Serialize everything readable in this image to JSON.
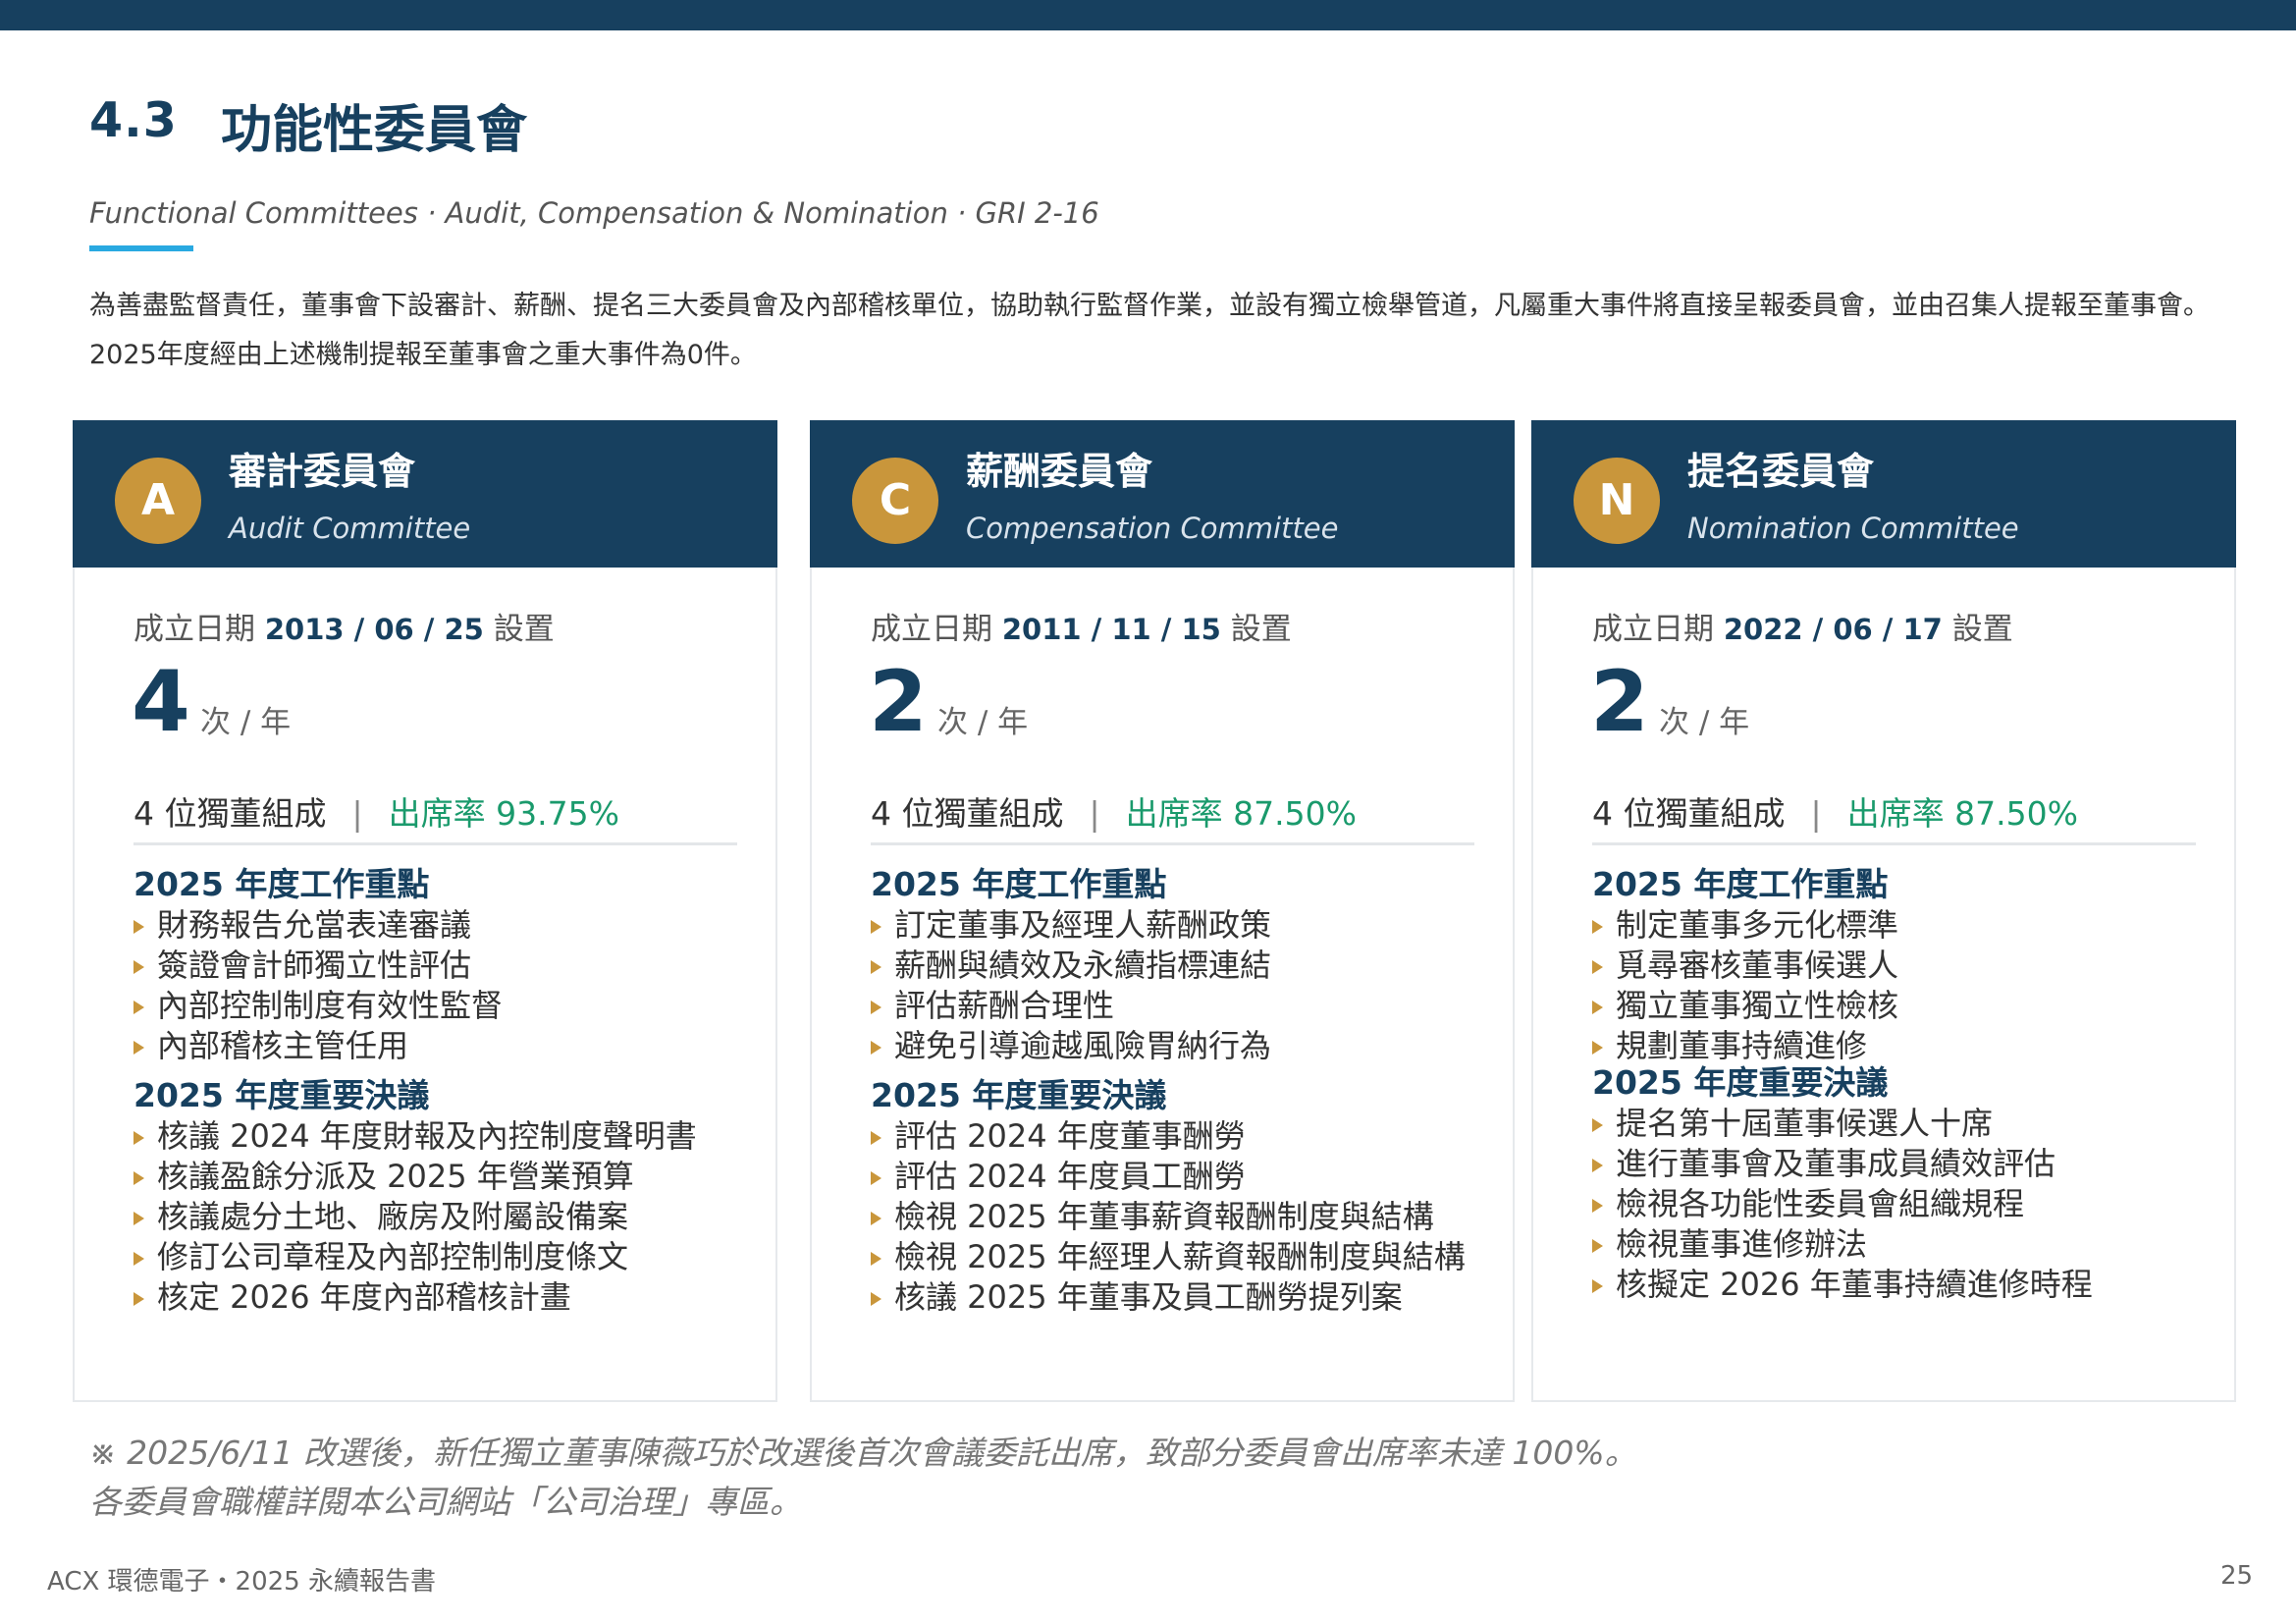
{
  "header": {
    "section_number": "4.3",
    "title": "功能性委員會",
    "subtitle": "Functional Committees · Audit, Compensation & Nomination  ·  GRI 2-16",
    "intro": "為善盡監督責任，董事會下設審計、薪酬、提名三大委員會及內部稽核單位，協助執行監督作業，並設有獨立檢舉管道，凡屬重大事件將直接呈報委員會，並由召集人提報至董事會。2025年度經由上述機制提報至董事會之重大事件為0件。"
  },
  "committees": [
    {
      "badge": "A",
      "title": "審計委員會",
      "subtitle": "Audit Committee",
      "established_label": "成立日期",
      "established_date": "2013 / 06 / 25",
      "established_suffix": "設置",
      "frequency": "4",
      "frequency_unit": "次 / 年",
      "members": "4 位獨董組成",
      "attendance": "出席率 93.75%",
      "focus_title": "2025 年度工作重點",
      "focus_items": [
        "財務報告允當表達審議",
        "簽證會計師獨立性評估",
        "內部控制制度有效性監督",
        "內部稽核主管任用"
      ],
      "resolutions_title": "2025 年度重要決議",
      "resolutions": [
        "核議 2024 年度財報及內控制度聲明書",
        "核議盈餘分派及 2025 年營業預算",
        "核議處分土地、廠房及附屬設備案",
        "修訂公司章程及內部控制制度條文",
        "核定 2026 年度內部稽核計畫"
      ]
    },
    {
      "badge": "C",
      "title": "薪酬委員會",
      "subtitle": "Compensation Committee",
      "established_label": "成立日期",
      "established_date": "2011 / 11 / 15",
      "established_suffix": "設置",
      "frequency": "2",
      "frequency_unit": "次 / 年",
      "members": "4 位獨董組成",
      "attendance": "出席率 87.50%",
      "focus_title": "2025 年度工作重點",
      "focus_items": [
        "訂定董事及經理人薪酬政策",
        "薪酬與績效及永續指標連結",
        "評估薪酬合理性",
        "避免引導逾越風險胃納行為"
      ],
      "resolutions_title": "2025 年度重要決議",
      "resolutions": [
        "評估 2024 年度董事酬勞",
        "評估 2024 年度員工酬勞",
        "檢視 2025 年董事薪資報酬制度與結構",
        "檢視 2025 年經理人薪資報酬制度與結構",
        "核議 2025 年董事及員工酬勞提列案"
      ]
    },
    {
      "badge": "N",
      "title": "提名委員會",
      "subtitle": "Nomination Committee",
      "established_label": "成立日期",
      "established_date": "2022 / 06 / 17",
      "established_suffix": "設置",
      "frequency": "2",
      "frequency_unit": "次 / 年",
      "members": "4 位獨董組成",
      "attendance": "出席率 87.50%",
      "focus_title": "2025 年度工作重點",
      "focus_items": [
        "制定董事多元化標準",
        "覓尋審核董事候選人",
        "獨立董事獨立性檢核",
        "規劃董事持續進修"
      ],
      "resolutions_title": "2025 年度重要決議",
      "resolutions": [
        "提名第十屆董事候選人十席",
        "進行董事會及董事成員績效評估",
        "檢視各功能性委員會組織規程",
        "檢視董事進修辦法",
        "核擬定 2026 年董事持續進修時程"
      ]
    }
  ],
  "notes": [
    "※ 2025/6/11 改選後，新任獨立董事陳薇巧於改選後首次會議委託出席，致部分委員會出席率未達 100%。",
    "各委員會職權詳閱本公司網站「公司治理」專區。"
  ],
  "footer": {
    "text": "ACX 環德電子・2025 永續報告書",
    "page": "25"
  },
  "colors": {
    "navy": "#17405f",
    "gold": "#c9963b",
    "green": "#1a9a6c",
    "accent_blue": "#29a9e1"
  }
}
